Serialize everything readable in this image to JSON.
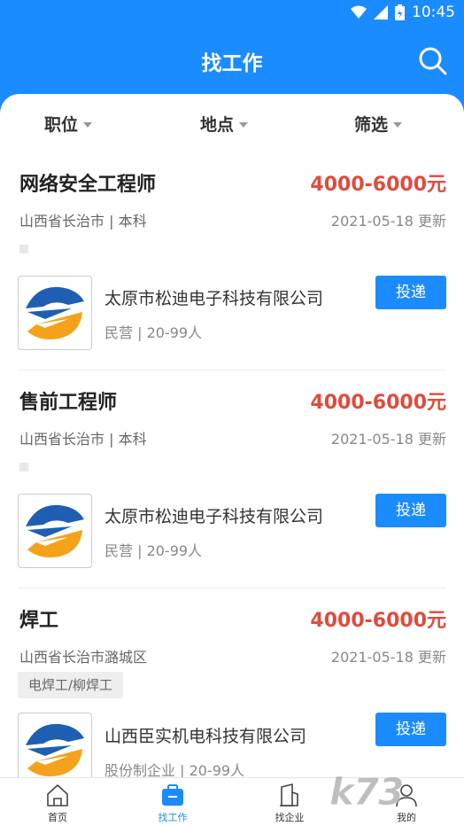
{
  "status_bar": {
    "time": "10:45"
  },
  "header": {
    "title": "找工作"
  },
  "filters": [
    {
      "label": "职位"
    },
    {
      "label": "地点"
    },
    {
      "label": "筛选"
    }
  ],
  "jobs": [
    {
      "title": "网络安全工程师",
      "salary": "4000-6000元",
      "location_education": "山西省长治市 | 本科",
      "updated": "2021-05-18 更新",
      "tag": "",
      "company": "太原市松迪电子科技有限公司",
      "company_meta": "民营 | 20-99人",
      "apply_label": "投递"
    },
    {
      "title": "售前工程师",
      "salary": "4000-6000元",
      "location_education": "山西省长治市 | 本科",
      "updated": "2021-05-18 更新",
      "tag": "",
      "company": "太原市松迪电子科技有限公司",
      "company_meta": "民营 | 20-99人",
      "apply_label": "投递"
    },
    {
      "title": "焊工",
      "salary": "4000-6000元",
      "location_education": "山西省长治市潞城区",
      "updated": "2021-05-18 更新",
      "tag": "电焊工/柳焊工",
      "company": "山西臣实机电科技有限公司",
      "company_meta": "股份制企业 | 20-99人",
      "apply_label": "投递"
    }
  ],
  "tabbar": [
    {
      "label": "首页",
      "icon": "home-icon"
    },
    {
      "label": "找工作",
      "icon": "briefcase-icon",
      "active": true
    },
    {
      "label": "找企业",
      "icon": "building-icon"
    },
    {
      "label": "我的",
      "icon": "user-icon"
    }
  ],
  "colors": {
    "primary": "#1a8cff",
    "salary": "#e24a3b"
  },
  "watermark": "k73"
}
